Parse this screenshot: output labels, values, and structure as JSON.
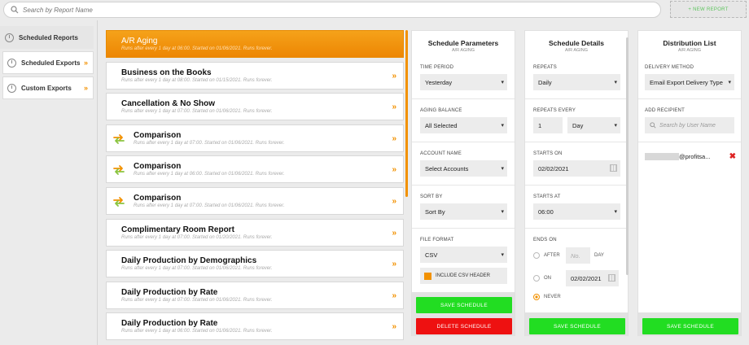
{
  "search": {
    "placeholder": "Search by Report Name"
  },
  "new_report_label": "+ NEW REPORT",
  "nav": [
    {
      "label": "Scheduled Reports",
      "active": true
    },
    {
      "label": "Scheduled Exports",
      "active": false
    },
    {
      "label": "Custom Exports",
      "active": false
    }
  ],
  "reports": [
    {
      "title": "A/R Aging",
      "subtitle": "Runs after every 1 day at 06:00. Started on 01/06/2021. Runs forever.",
      "icon": ""
    },
    {
      "title": "Business on the Books",
      "subtitle": "Runs after every 1 day at 08:00. Started on 01/15/2021. Runs forever.",
      "icon": ""
    },
    {
      "title": "Cancellation & No Show",
      "subtitle": "Runs after every 1 day at 07:00. Started on 01/06/2021. Runs forever.",
      "icon": ""
    },
    {
      "title": "Comparison",
      "subtitle": "Runs after every 1 day at 07:00. Started on 01/06/2021. Runs forever.",
      "icon": "swap-icon"
    },
    {
      "title": "Comparison",
      "subtitle": "Runs after every 1 day at 06:00. Started on 01/06/2021. Runs forever.",
      "icon": "swap-icon"
    },
    {
      "title": "Comparison",
      "subtitle": "Runs after every 1 day at 07:00. Started on 01/06/2021. Runs forever.",
      "icon": "swap-icon"
    },
    {
      "title": "Complimentary Room Report",
      "subtitle": "Runs after every 1 day at 07:00. Started on 01/20/2021. Runs forever.",
      "icon": ""
    },
    {
      "title": "Daily Production by Demographics",
      "subtitle": "Runs after every 1 day at 07:00. Started on 01/06/2021. Runs forever.",
      "icon": ""
    },
    {
      "title": "Daily Production by Rate",
      "subtitle": "Runs after every 1 day at 07:00. Started on 01/06/2021. Runs forever.",
      "icon": ""
    },
    {
      "title": "Daily Production by Rate",
      "subtitle": "Runs after every 1 day at 06:00. Started on 01/06/2021. Runs forever.",
      "icon": ""
    }
  ],
  "params": {
    "title": "Schedule Parameters",
    "sub": "A/R AGING",
    "time_period_label": "TIME PERIOD",
    "time_period": "Yesterday",
    "aging_label": "AGING BALANCE",
    "aging": "All Selected",
    "account_label": "ACCOUNT NAME",
    "account": "Select Accounts",
    "sort_label": "SORT BY",
    "sort": "Sort By",
    "format_label": "FILE FORMAT",
    "format": "CSV",
    "csv_header_label": "INCLUDE CSV HEADER",
    "save_label": "SAVE SCHEDULE",
    "delete_label": "DELETE SCHEDULE"
  },
  "details": {
    "title": "Schedule Details",
    "sub": "A/R AGING",
    "repeats_label": "REPEATS",
    "repeats": "Daily",
    "repeats_every_label": "REPEATS EVERY",
    "repeats_every_num": "1",
    "repeats_every_unit": "Day",
    "starts_on_label": "STARTS ON",
    "starts_on": "02/02/2021",
    "starts_at_label": "STARTS AT",
    "starts_at": "06:00",
    "ends_on_label": "ENDS ON",
    "after_label": "AFTER",
    "after_placeholder": "No.",
    "day_label": "DAY",
    "on_label": "ON",
    "on_date": "02/02/2021",
    "never_label": "NEVER",
    "save_label": "SAVE SCHEDULE"
  },
  "dist": {
    "title": "Distribution List",
    "sub": "A/R AGING",
    "method_label": "DELIVERY METHOD",
    "method": "Email Export Delivery Type",
    "recipient_label": "ADD RECIPIENT",
    "recipient_placeholder": "Search by User Name",
    "recipient_email": "@profitsa...",
    "save_label": "SAVE SCHEDULE"
  },
  "colors": {
    "accent": "#f29100",
    "save": "#22dd22",
    "delete": "#ee1111",
    "remove": "#dd2222"
  }
}
